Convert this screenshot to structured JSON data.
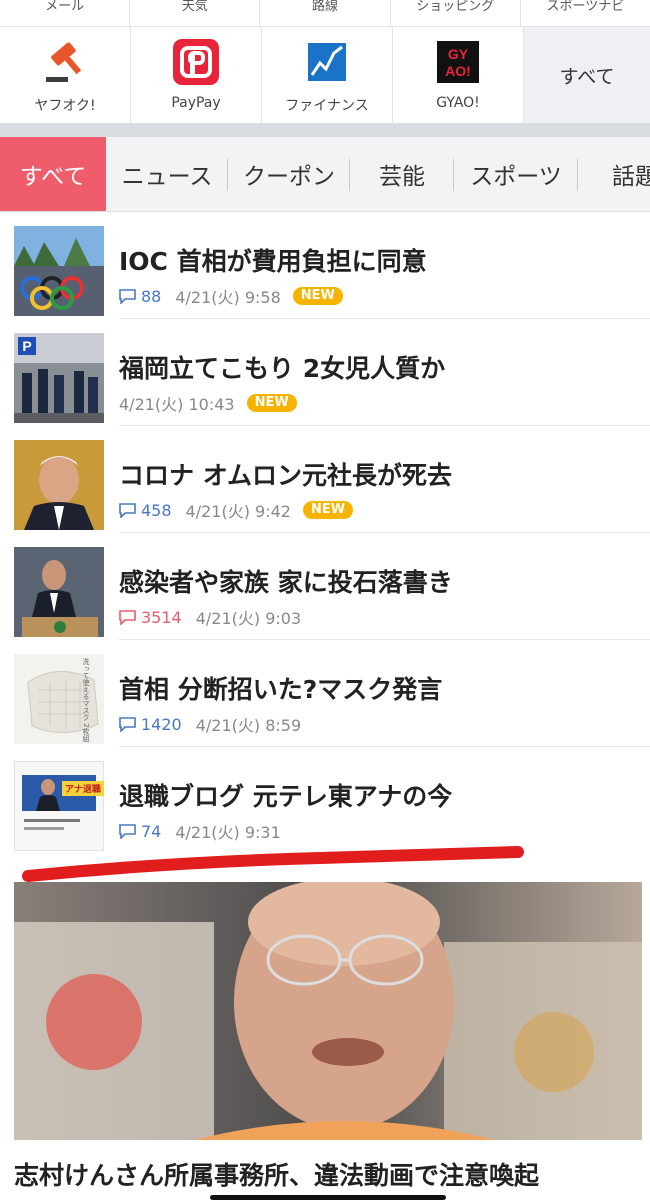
{
  "services_top": [
    "メール",
    "天気",
    "路線",
    "ショッピング",
    "スポーツナビ"
  ],
  "services": [
    {
      "name": "ヤフオク!",
      "icon": "auction-gavel-icon"
    },
    {
      "name": "PayPay",
      "icon": "paypay-icon"
    },
    {
      "name": "ファイナンス",
      "icon": "finance-chart-icon"
    },
    {
      "name": "GYAO!",
      "icon": "gyao-icon",
      "logo_text": "GY\nAO!"
    }
  ],
  "services_all": "すべて",
  "tabs": [
    "すべて",
    "ニュース",
    "クーポン",
    "芸能",
    "スポーツ",
    "話題"
  ],
  "news": [
    {
      "title": "IOC 首相が費用負担に同意",
      "comments": "88",
      "time": "4/21(火) 9:58",
      "new": "NEW",
      "comment_color": "#4a78c2"
    },
    {
      "title": "福岡立てこもり 2女児人質か",
      "comments": "",
      "time": "4/21(火) 10:43",
      "new": "NEW",
      "comment_color": "#4a78c2"
    },
    {
      "title": "コロナ オムロン元社長が死去",
      "comments": "458",
      "time": "4/21(火) 9:42",
      "new": "NEW",
      "comment_color": "#4a78c2"
    },
    {
      "title": "感染者や家族 家に投石落書き",
      "comments": "3514",
      "time": "4/21(火) 9:03",
      "new": "",
      "comment_color": "#e85c6e"
    },
    {
      "title": "首相 分断招いた?マスク発言",
      "comments": "1420",
      "time": "4/21(火) 8:59",
      "new": "",
      "comment_color": "#4a78c2"
    },
    {
      "title": "退職ブログ 元テレ東アナの今",
      "comments": "74",
      "time": "4/21(火) 9:31",
      "new": "",
      "comment_color": "#4a78c2"
    }
  ],
  "thumb_texts": {
    "mask_text": "洗って使えるマスク 2枚組",
    "blog_text": "アナ退職"
  },
  "feature": {
    "title": "志村けんさん所属事務所、違法動画で注意喚起"
  },
  "colors": {
    "accent": "#ef5c6c",
    "new_badge": "#f6b300",
    "comment_blue": "#4a78c2",
    "comment_red": "#e85c6e"
  }
}
